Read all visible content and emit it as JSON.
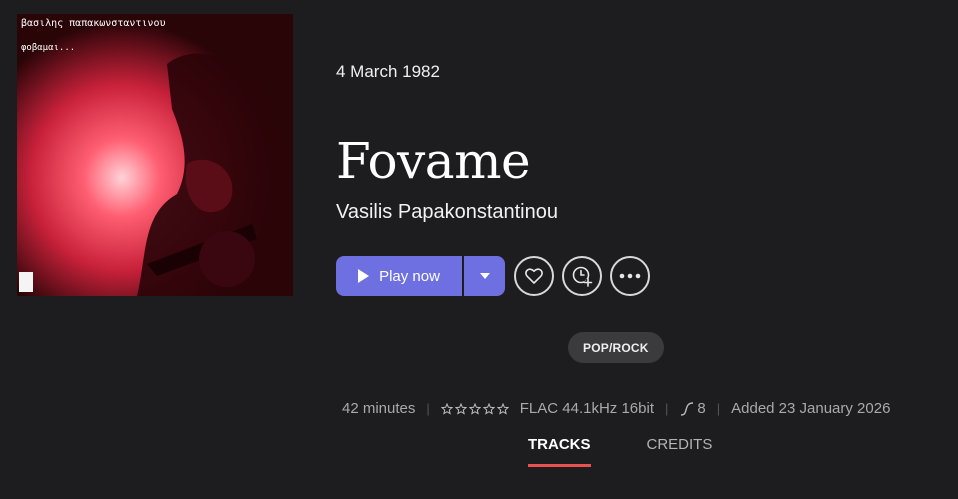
{
  "cover": {
    "line1": "βασιλης παπακωνσταντινου",
    "line2": "φοβαμαι..."
  },
  "album": {
    "release_date": "4 March 1982",
    "title": "Fovame",
    "artist": "Vasilis Papakonstantinou",
    "genre": "POP/ROCK"
  },
  "actions": {
    "play_label": "Play now"
  },
  "meta": {
    "duration": "42 minutes",
    "rating_stars": 0,
    "format": "FLAC 44.1kHz 16bit",
    "hires_count": "8",
    "added": "Added 23 January 2026"
  },
  "tabs": [
    {
      "label": "TRACKS",
      "active": true
    },
    {
      "label": "CREDITS",
      "active": false
    }
  ],
  "colors": {
    "background": "#1d1d1f",
    "accent": "#6e6fe0",
    "tab_indicator": "#e9524f"
  }
}
